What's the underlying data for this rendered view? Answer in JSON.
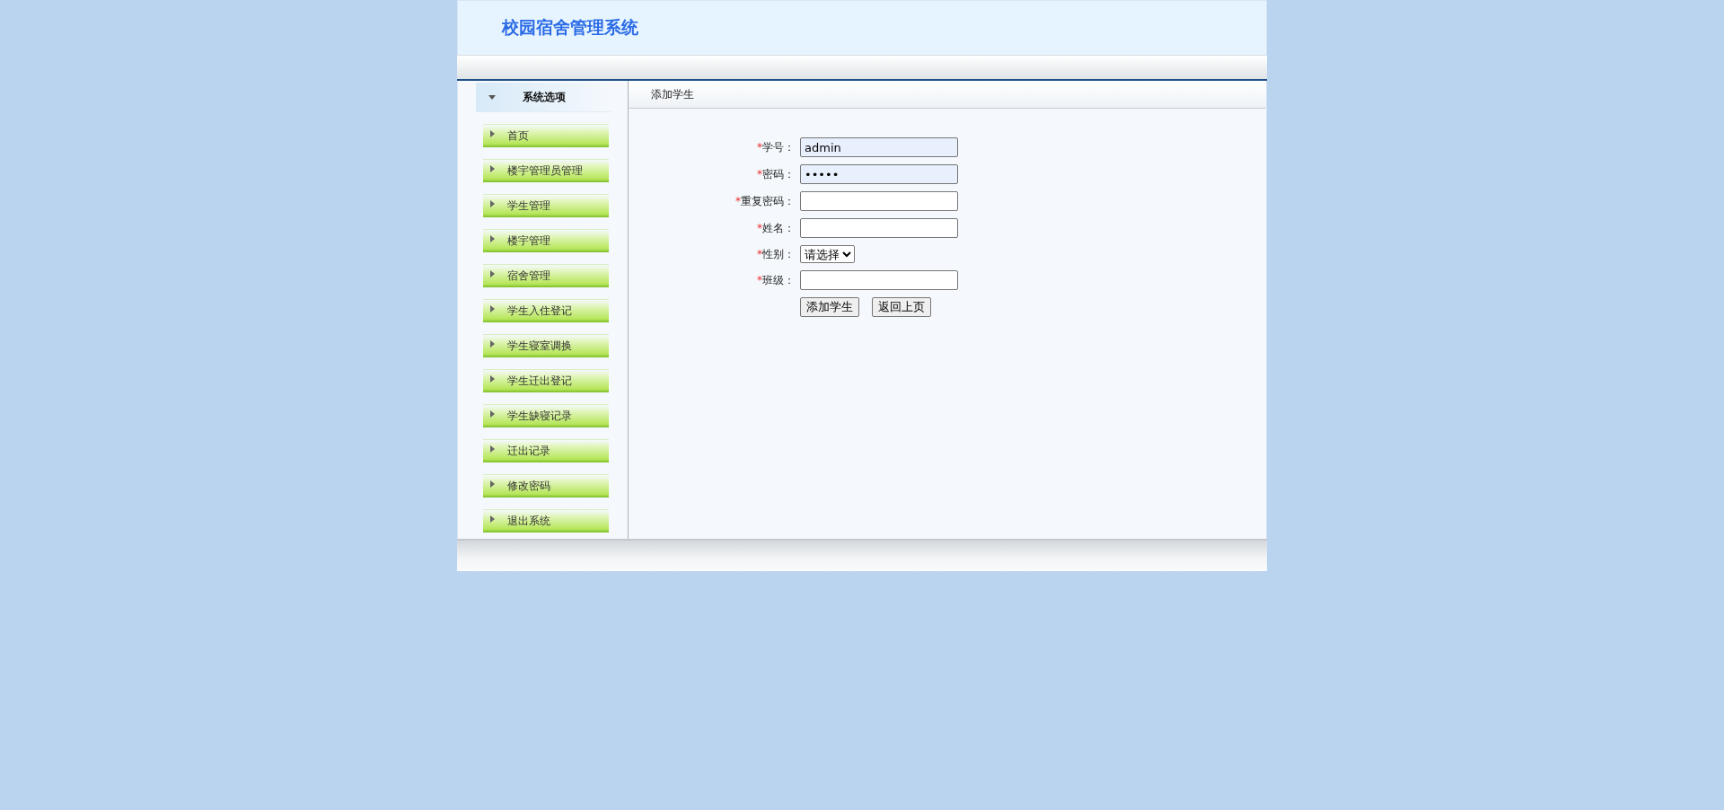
{
  "header": {
    "title": "校园宿舍管理系统"
  },
  "sidebar": {
    "title": "系统选项",
    "items": [
      {
        "label": "首页"
      },
      {
        "label": "楼宇管理员管理"
      },
      {
        "label": "学生管理"
      },
      {
        "label": "楼宇管理"
      },
      {
        "label": "宿舍管理"
      },
      {
        "label": "学生入住登记"
      },
      {
        "label": "学生寝室调换"
      },
      {
        "label": "学生迁出登记"
      },
      {
        "label": "学生缺寝记录"
      },
      {
        "label": "迁出记录"
      },
      {
        "label": "修改密码"
      },
      {
        "label": "退出系统"
      }
    ]
  },
  "content": {
    "title": "添加学生",
    "form": {
      "fields": [
        {
          "kind": "text",
          "mark": "*",
          "label": "学号：",
          "value": "admin",
          "autofilled": true
        },
        {
          "kind": "text",
          "mark": "*",
          "label": "密码：",
          "value": "•••••",
          "autofilled": true
        },
        {
          "kind": "text",
          "mark": "*",
          "label": "重复密码：",
          "autofilled": false
        },
        {
          "kind": "text",
          "mark": "*",
          "label": "姓名：",
          "autofilled": false
        },
        {
          "kind": "select",
          "mark": "*",
          "label": "性别：",
          "value": "请选择"
        },
        {
          "kind": "text",
          "mark": "*",
          "label": "班级：",
          "autofilled": false
        }
      ],
      "buttons": [
        "添加学生",
        "返回上页"
      ]
    }
  }
}
